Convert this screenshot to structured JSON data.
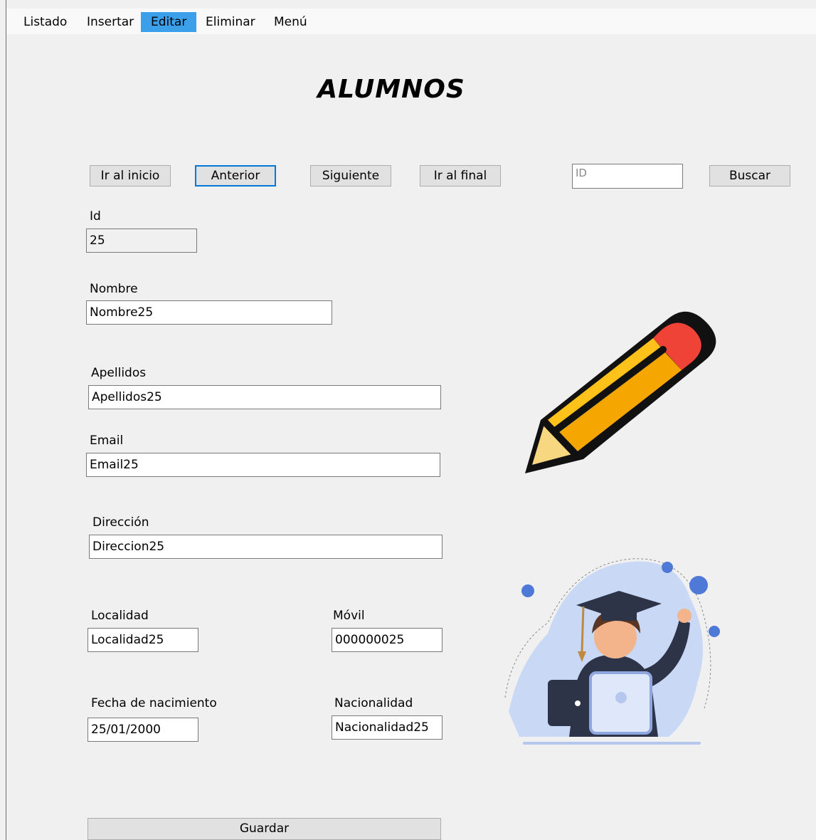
{
  "menu": {
    "items": [
      {
        "label": "Listado"
      },
      {
        "label": "Insertar"
      },
      {
        "label": "Editar"
      },
      {
        "label": "Eliminar"
      },
      {
        "label": "Menú"
      }
    ],
    "active_item": "Editar",
    "active_color": "#3c9fe9"
  },
  "page": {
    "title": "ALUMNOS"
  },
  "nav": {
    "first_label": "Ir al inicio",
    "prev_label": "Anterior",
    "next_label": "Siguiente",
    "last_label": "Ir al final",
    "search_placeholder": "ID",
    "search_label": "Buscar"
  },
  "form": {
    "id": {
      "label": "Id",
      "value": "25"
    },
    "nombre": {
      "label": "Nombre",
      "value": "Nombre25"
    },
    "apellidos": {
      "label": "Apellidos",
      "value": "Apellidos25"
    },
    "email": {
      "label": "Email",
      "value": "Email25"
    },
    "direccion": {
      "label": "Dirección",
      "value": "Direccion25"
    },
    "localidad": {
      "label": "Localidad",
      "value": "Localidad25"
    },
    "movil": {
      "label": "Móvil",
      "value": "000000025"
    },
    "fecha": {
      "label": "Fecha de nacimiento",
      "value": "25/01/2000"
    },
    "nacionalidad": {
      "label": "Nacionalidad",
      "value": "Nacionalidad25"
    },
    "save_label": "Guardar"
  },
  "icons": {
    "pencil": "pencil-icon",
    "graduate": "graduate-illustration"
  }
}
